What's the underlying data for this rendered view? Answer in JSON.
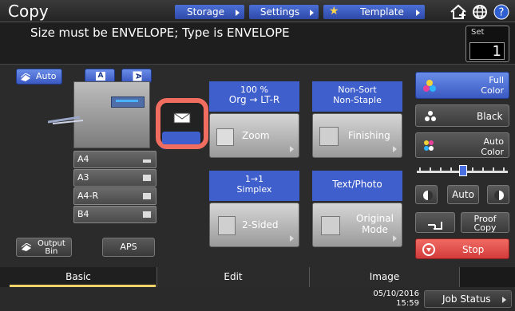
{
  "app": {
    "title": "Copy"
  },
  "tabs_top": {
    "storage": "Storage",
    "settings": "Settings",
    "template": "Template"
  },
  "message": "Size must be ENVELOPE; Type is ENVELOPE",
  "set": {
    "label": "Set",
    "value": "1"
  },
  "left": {
    "auto_label": "Auto",
    "orient_buttons": [
      "A",
      "A"
    ],
    "trays": [
      "A4",
      "A3",
      "A4-R",
      "B4"
    ],
    "output_bin_label": "Output\nBin",
    "aps_label": "APS"
  },
  "functions": {
    "zoom": {
      "top": "100 %",
      "sub": "Org → LT-R",
      "button": "Zoom"
    },
    "finishing": {
      "top": "Non-Sort",
      "sub": "Non-Staple",
      "button": "Finishing"
    },
    "two_sided": {
      "top": "1→1",
      "sub": "Simplex",
      "button": "2-Sided"
    },
    "original_mode": {
      "top": "Text/Photo",
      "button": "Original\nMode"
    }
  },
  "right": {
    "full_color": "Full\nColor",
    "black": "Black",
    "auto_color": "Auto\nColor",
    "auto_density": "Auto",
    "proof_copy": "Proof\nCopy",
    "stop": "Stop"
  },
  "bottom_tabs": {
    "basic": "Basic",
    "edit": "Edit",
    "image": "Image"
  },
  "status": {
    "date": "05/10/2016",
    "time": "15:59",
    "job_status": "Job Status"
  },
  "colors": {
    "accent_blue": "#3f5fcc",
    "highlight": "#f06d5f",
    "stop": "#e24e4e",
    "basic_tab_underline": "#f2d36b"
  }
}
